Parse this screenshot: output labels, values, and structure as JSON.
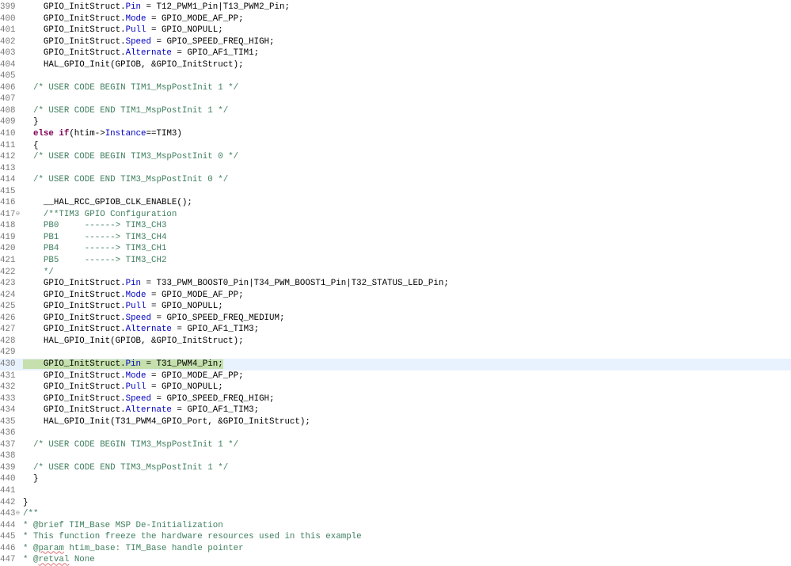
{
  "editor": {
    "current_line": 430,
    "lines": [
      {
        "n": "399",
        "s": [
          [
            "    GPIO_InitStruct.",
            ""
          ],
          [
            "Pin",
            "f"
          ],
          [
            " = T12_PWM1_Pin|T13_PWM2_Pin;",
            ""
          ]
        ]
      },
      {
        "n": "400",
        "s": [
          [
            "    GPIO_InitStruct.",
            ""
          ],
          [
            "Mode",
            "f"
          ],
          [
            " = GPIO_MODE_AF_PP;",
            ""
          ]
        ]
      },
      {
        "n": "401",
        "s": [
          [
            "    GPIO_InitStruct.",
            ""
          ],
          [
            "Pull",
            "f"
          ],
          [
            " = GPIO_NOPULL;",
            ""
          ]
        ]
      },
      {
        "n": "402",
        "s": [
          [
            "    GPIO_InitStruct.",
            ""
          ],
          [
            "Speed",
            "f"
          ],
          [
            " = GPIO_SPEED_FREQ_HIGH;",
            ""
          ]
        ]
      },
      {
        "n": "403",
        "s": [
          [
            "    GPIO_InitStruct.",
            ""
          ],
          [
            "Alternate",
            "f"
          ],
          [
            " = GPIO_AF1_TIM1;",
            ""
          ]
        ]
      },
      {
        "n": "404",
        "s": [
          [
            "    HAL_GPIO_Init(GPIOB, &GPIO_InitStruct);",
            ""
          ]
        ]
      },
      {
        "n": "405",
        "s": []
      },
      {
        "n": "406",
        "s": [
          [
            "  /* USER CODE BEGIN TIM1_MspPostInit 1 */",
            "c"
          ]
        ]
      },
      {
        "n": "407",
        "s": []
      },
      {
        "n": "408",
        "s": [
          [
            "  /* USER CODE END TIM1_MspPostInit 1 */",
            "c"
          ]
        ]
      },
      {
        "n": "409",
        "s": [
          [
            "  }",
            ""
          ]
        ]
      },
      {
        "n": "410",
        "s": [
          [
            "  ",
            ""
          ],
          [
            "else if",
            "k"
          ],
          [
            "(htim->",
            ""
          ],
          [
            "Instance",
            "f"
          ],
          [
            "==TIM3)",
            ""
          ]
        ]
      },
      {
        "n": "411",
        "s": [
          [
            "  {",
            ""
          ]
        ]
      },
      {
        "n": "412",
        "s": [
          [
            "  /* USER CODE BEGIN TIM3_MspPostInit 0 */",
            "c"
          ]
        ]
      },
      {
        "n": "413",
        "s": []
      },
      {
        "n": "414",
        "s": [
          [
            "  /* USER CODE END TIM3_MspPostInit 0 */",
            "c"
          ]
        ]
      },
      {
        "n": "415",
        "s": []
      },
      {
        "n": "416",
        "s": [
          [
            "    __HAL_RCC_GPIOB_CLK_ENABLE();",
            ""
          ]
        ]
      },
      {
        "n": "417",
        "fold": true,
        "s": [
          [
            "    /**TIM3 GPIO Configuration",
            "c"
          ]
        ]
      },
      {
        "n": "418",
        "s": [
          [
            "    PB0     ------> TIM3_CH3",
            "c"
          ]
        ]
      },
      {
        "n": "419",
        "s": [
          [
            "    PB1     ------> TIM3_CH4",
            "c"
          ]
        ]
      },
      {
        "n": "420",
        "s": [
          [
            "    PB4     ------> TIM3_CH1",
            "c"
          ]
        ]
      },
      {
        "n": "421",
        "s": [
          [
            "    PB5     ------> TIM3_CH2",
            "c"
          ]
        ]
      },
      {
        "n": "422",
        "s": [
          [
            "    */",
            "c"
          ]
        ]
      },
      {
        "n": "423",
        "s": [
          [
            "    GPIO_InitStruct.",
            ""
          ],
          [
            "Pin",
            "f"
          ],
          [
            " = T33_PWM_BOOST0_Pin|T34_PWM_BOOST1_Pin|T32_STATUS_LED_Pin;",
            ""
          ]
        ]
      },
      {
        "n": "424",
        "s": [
          [
            "    GPIO_InitStruct.",
            ""
          ],
          [
            "Mode",
            "f"
          ],
          [
            " = GPIO_MODE_AF_PP;",
            ""
          ]
        ]
      },
      {
        "n": "425",
        "s": [
          [
            "    GPIO_InitStruct.",
            ""
          ],
          [
            "Pull",
            "f"
          ],
          [
            " = GPIO_NOPULL;",
            ""
          ]
        ]
      },
      {
        "n": "426",
        "s": [
          [
            "    GPIO_InitStruct.",
            ""
          ],
          [
            "Speed",
            "f"
          ],
          [
            " = GPIO_SPEED_FREQ_MEDIUM;",
            ""
          ]
        ]
      },
      {
        "n": "427",
        "s": [
          [
            "    GPIO_InitStruct.",
            ""
          ],
          [
            "Alternate",
            "f"
          ],
          [
            " = GPIO_AF1_TIM3;",
            ""
          ]
        ]
      },
      {
        "n": "428",
        "s": [
          [
            "    HAL_GPIO_Init(GPIOB, &GPIO_InitStruct);",
            ""
          ]
        ]
      },
      {
        "n": "429",
        "s": []
      },
      {
        "n": "430",
        "selected": true,
        "s": [
          [
            "    GPIO_InitStruct.",
            ""
          ],
          [
            "Pin",
            "f"
          ],
          [
            " = T31_PWM4_Pin;",
            ""
          ]
        ]
      },
      {
        "n": "431",
        "s": [
          [
            "    GPIO_InitStruct.",
            ""
          ],
          [
            "Mode",
            "f"
          ],
          [
            " = GPIO_MODE_AF_PP;",
            ""
          ]
        ]
      },
      {
        "n": "432",
        "s": [
          [
            "    GPIO_InitStruct.",
            ""
          ],
          [
            "Pull",
            "f"
          ],
          [
            " = GPIO_NOPULL;",
            ""
          ]
        ]
      },
      {
        "n": "433",
        "s": [
          [
            "    GPIO_InitStruct.",
            ""
          ],
          [
            "Speed",
            "f"
          ],
          [
            " = GPIO_SPEED_FREQ_HIGH;",
            ""
          ]
        ]
      },
      {
        "n": "434",
        "s": [
          [
            "    GPIO_InitStruct.",
            ""
          ],
          [
            "Alternate",
            "f"
          ],
          [
            " = GPIO_AF1_TIM3;",
            ""
          ]
        ]
      },
      {
        "n": "435",
        "s": [
          [
            "    HAL_GPIO_Init(T31_PWM4_GPIO_Port, &GPIO_InitStruct);",
            ""
          ]
        ]
      },
      {
        "n": "436",
        "s": []
      },
      {
        "n": "437",
        "s": [
          [
            "  /* USER CODE BEGIN TIM3_MspPostInit 1 */",
            "c"
          ]
        ]
      },
      {
        "n": "438",
        "s": []
      },
      {
        "n": "439",
        "s": [
          [
            "  /* USER CODE END TIM3_MspPostInit 1 */",
            "c"
          ]
        ]
      },
      {
        "n": "440",
        "s": [
          [
            "  }",
            ""
          ]
        ]
      },
      {
        "n": "441",
        "s": []
      },
      {
        "n": "442",
        "s": [
          [
            "}",
            ""
          ]
        ]
      },
      {
        "n": "443",
        "fold": true,
        "s": [
          [
            "/**",
            "c"
          ]
        ]
      },
      {
        "n": "444",
        "s": [
          [
            "* @brief TIM_Base MSP De-Initialization",
            "c"
          ]
        ]
      },
      {
        "n": "445",
        "s": [
          [
            "* This function freeze the hardware resources used in this example",
            "c"
          ]
        ]
      },
      {
        "n": "446",
        "s": [
          [
            "* @",
            "c"
          ],
          [
            "param",
            "c u"
          ],
          [
            " htim_base: TIM_Base handle pointer",
            "c"
          ]
        ]
      },
      {
        "n": "447",
        "s": [
          [
            "* @",
            "c"
          ],
          [
            "retval",
            "c u"
          ],
          [
            " None",
            "c"
          ]
        ]
      }
    ]
  }
}
